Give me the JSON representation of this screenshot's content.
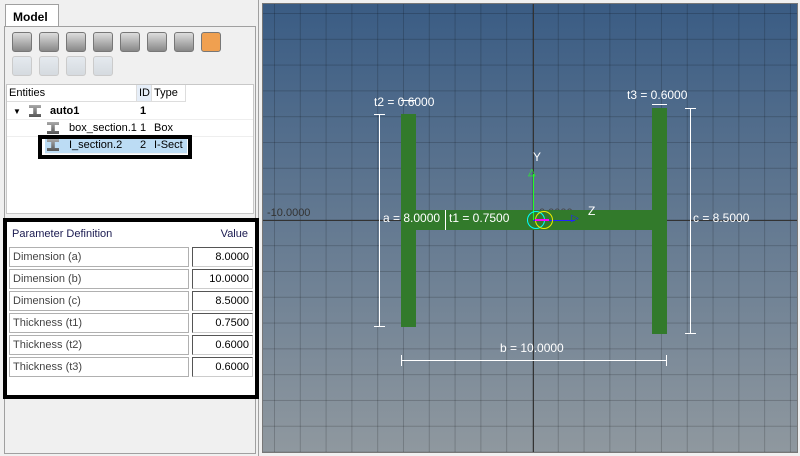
{
  "panel": {
    "tab": "Model",
    "toolbar_icons": [
      "folder-icon",
      "connectors-icon",
      "part-icon",
      "cross-section-icon",
      "thickness-icon",
      "mesh-icon",
      "assembly-icon",
      "beam-section-icon"
    ],
    "toolbar2_icons": [
      "plane-icon",
      "show-icon",
      "hide-icon",
      "isolate-icon"
    ],
    "tree": {
      "headers": {
        "entities": "Entities",
        "id": "ID",
        "type": "Type"
      },
      "rows": [
        {
          "name": "auto1",
          "id": "1",
          "type": ""
        },
        {
          "name": "box_section.1",
          "id": "1",
          "type": "Box"
        },
        {
          "name": "I_section.2",
          "id": "2",
          "type": "I-Sect",
          "selected": true
        }
      ]
    },
    "params": {
      "header_name": "Parameter Definition",
      "header_value": "Value",
      "rows": [
        {
          "name": "Dimension (a)",
          "value": "8.0000"
        },
        {
          "name": "Dimension (b)",
          "value": "10.0000"
        },
        {
          "name": "Dimension (c)",
          "value": "8.5000"
        },
        {
          "name": "Thickness (t1)",
          "value": "0.7500"
        },
        {
          "name": "Thickness (t2)",
          "value": "0.6000"
        },
        {
          "name": "Thickness (t3)",
          "value": "0.6000"
        }
      ]
    }
  },
  "viewport": {
    "axis_left": "-10.0000",
    "origin": "0.0000",
    "y_axis": "Y",
    "z_axis": "Z",
    "labels": {
      "t2": "t2 = 0.6000",
      "t3": "t3 = 0.6000",
      "a": "a = 8.0000",
      "t1": "t1 = 0.7500",
      "c": "c = 8.5000",
      "b": "b = 10.0000"
    },
    "section_color": "#327a2b"
  }
}
